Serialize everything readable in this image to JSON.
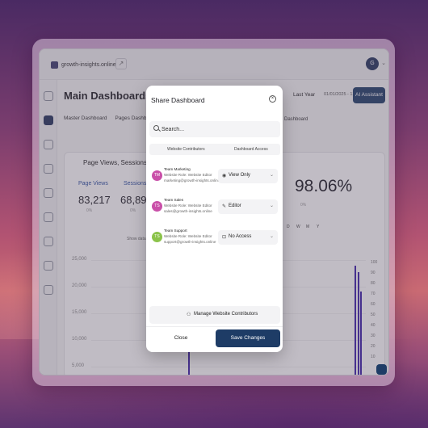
{
  "colors": {
    "accent": "#1e3c66",
    "chart_bar": "#3a1ea8"
  },
  "topbar": {
    "site": "growth-insights.online",
    "avatar_initials": "G"
  },
  "page": {
    "title": "Main Dashboards"
  },
  "header": {
    "last_year": "Last Year",
    "date_range": "01/01/2025 - 12/31/2025",
    "ai_button": "AI Assistant"
  },
  "tabs": [
    "Master Dashboard",
    "Pages Dashboard"
  ],
  "tab_right": "Dashboard",
  "card": {
    "title": "Page Views, Sessions ..."
  },
  "metrics": [
    {
      "label": "Page Views",
      "value": "83,217",
      "pct": "0%"
    },
    {
      "label": "Sessions",
      "value": "68,898",
      "pct": "0%"
    }
  ],
  "big_metric": {
    "value": "98.06%",
    "pct": "0%"
  },
  "show_by": "Show data by:",
  "periods": [
    "D",
    "W",
    "M",
    "Y"
  ],
  "y_ticks": [
    "25,000",
    "20,000",
    "15,000",
    "10,000",
    "5,000"
  ],
  "y_ticks_right": [
    "100",
    "90",
    "80",
    "70",
    "60",
    "50",
    "40",
    "30",
    "20",
    "10"
  ],
  "modal": {
    "title": "Share Dashboard",
    "search_placeholder": "Search...",
    "col_contributors": "Website Contributors",
    "col_access": "Dashboard Access",
    "contributors": [
      {
        "initials": "TM",
        "name": "Team Marketing",
        "role": "Website Role: Website Editor",
        "email": "marketing@growth-insights.online",
        "access": "View Only",
        "color": "#c94fa8"
      },
      {
        "initials": "TS",
        "name": "Team Sales",
        "role": "Website Role: Website Editor",
        "email": "sales@growth-insights.online",
        "access": "Editor",
        "color": "#c94fa8"
      },
      {
        "initials": "TS",
        "name": "Team Support",
        "role": "Website Role: Website Editor",
        "email": "support@growth-insights.online",
        "access": "No Access",
        "color": "#8bc34a"
      }
    ],
    "manage": "Manage Website Contributors",
    "close": "Close",
    "save": "Save Changes"
  }
}
